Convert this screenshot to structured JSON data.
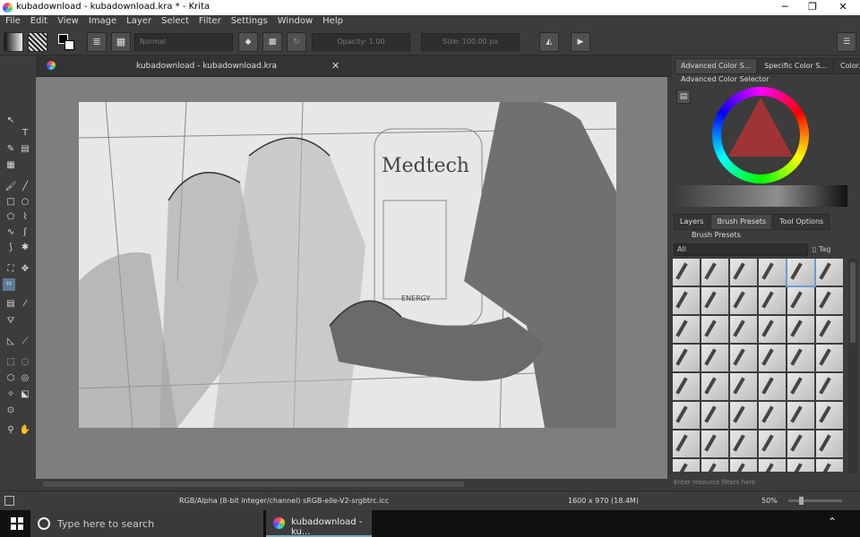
{
  "window": {
    "title": "kubadownload - kubadownload.kra * - Krita"
  },
  "menu": [
    "File",
    "Edit",
    "View",
    "Image",
    "Layer",
    "Select",
    "Filter",
    "Settings",
    "Window",
    "Help"
  ],
  "toolbar": {
    "blend_mode": "Normal",
    "opacity": "Opacity: 1.00",
    "size": "Size: 100.00 px"
  },
  "document": {
    "tab_title": "kubadownload - kubadownload.kra",
    "art_sign": "Medtech",
    "art_label": "ENERGY"
  },
  "dock": {
    "top_tabs": [
      "Advanced Color S...",
      "Specific Color S...",
      "Color..."
    ],
    "color_selector_title": "Advanced Color Selector",
    "mid_tabs": [
      "Layers",
      "Brush Presets",
      "Tool Options"
    ],
    "brush_presets_title": "Brush Presets",
    "filter_value": "All",
    "tag_label": "Tag",
    "filter_placeholder": "Enter resource filters here"
  },
  "status": {
    "color_space": "RGB/Alpha (8-bit integer/channel)  sRGB-elle-V2-srgbtrc.icc",
    "dimensions": "1600 x 970 (18.4M)",
    "zoom": "50%"
  },
  "taskbar": {
    "search_placeholder": "Type here to search",
    "app_label": "kubadownload - ku..."
  },
  "colors": {
    "bg": "#3c3c3c",
    "canvas_bg": "#7e7e7e",
    "accent": "#6a9ed0"
  },
  "icons": [
    "windows-logo-icon",
    "cortana-circle-icon",
    "krita-icon",
    "chevron-up-icon"
  ]
}
